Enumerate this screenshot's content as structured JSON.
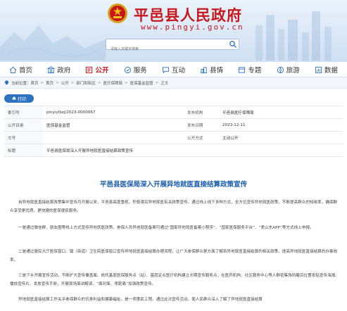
{
  "header": {
    "title": "平邑县人民政府",
    "url": "www.pingyi.gov.cn",
    "search_placeholder": "请输入关键字搜索"
  },
  "nav": {
    "items": [
      {
        "label": "首页",
        "icon": "home-icon"
      },
      {
        "label": "政府",
        "icon": "government-icon"
      },
      {
        "label": "公开",
        "icon": "open-icon",
        "active": true
      },
      {
        "label": "服务",
        "icon": "service-icon"
      },
      {
        "label": "互动",
        "icon": "interaction-icon"
      },
      {
        "label": "县情",
        "icon": "county-info-icon"
      },
      {
        "label": "专题",
        "icon": "topic-icon"
      },
      {
        "label": "旅游",
        "icon": "tourism-icon"
      },
      {
        "label": "数据",
        "icon": "data-icon"
      }
    ]
  },
  "breadcrumb": {
    "prefix": "当前位置：首页",
    "items": [
      "首页",
      "公开",
      "部门和街区",
      "医疗保障局",
      "医保基金监管",
      "正文"
    ]
  },
  "print_label": "打印",
  "info": {
    "rows": [
      {
        "k1": "索引号",
        "v1": "pinyiylbzj/2023-0000067",
        "k2": "发布机构",
        "v2": "平邑县医疗保障局"
      },
      {
        "k1": "公开目录",
        "v1": "医保基金监管",
        "k2": "发布日期",
        "v2": "2023-12-11"
      },
      {
        "k1": "文号",
        "v1": "",
        "k2": "公开方式",
        "v2": "主动公开"
      },
      {
        "k1": "标题",
        "v1": "平邑县医保局深入开展异地就医直接结算政策宣传",
        "k2": "",
        "v2": ""
      }
    ]
  },
  "article": {
    "title": "平邑县医保局深入开展异地就医直接结算政策宣传",
    "paragraphs": [
      "自异地就医直接结算政策集中宣传月开展以来，平邑县高度重视，积极落实异地就医有关政策宣传，通过线上线下多种方式，全方位宣传异地就医政策，不断提高群众的知晓率，确保群众享受更优质、更快捷的医保便民服务。",
      "一是通过微信群、朋友圈等线上方式宣传异地就医政策。参保人员异地就医备案可通过“国家异地就医备案小程序”、“国家医保服务平台”、“爱山东APP”等方式线上申报。",
      "二是通过便民大厅医保窗口、镇（街道）卫生院医保窗口宣传异地就医直接结算办理流程，让广大参保群众更方面了解到异地就医直接结算的相关政策，提高异地就医直接结算的办事效率。",
      "三是下乡开展宣传活动，不断扩大宣传覆盖面。依托基层医保服务点（站）、基层定点医疗机构建立长期宣传服务点，在医药机构、社区服务中心等人群密集场所醒目位置张贴宣传海报、播放宣传片、发放宣传手册，开展现场面讲解读，“面对面、零距离”加强政策宣传。",
      "异地就医直接结算工作关乎参保群众的切身利益和健康福祉，是一项惠民工程。通过此次宣传活动，使人民群众深入了解了异地就医直接结算"
    ]
  }
}
